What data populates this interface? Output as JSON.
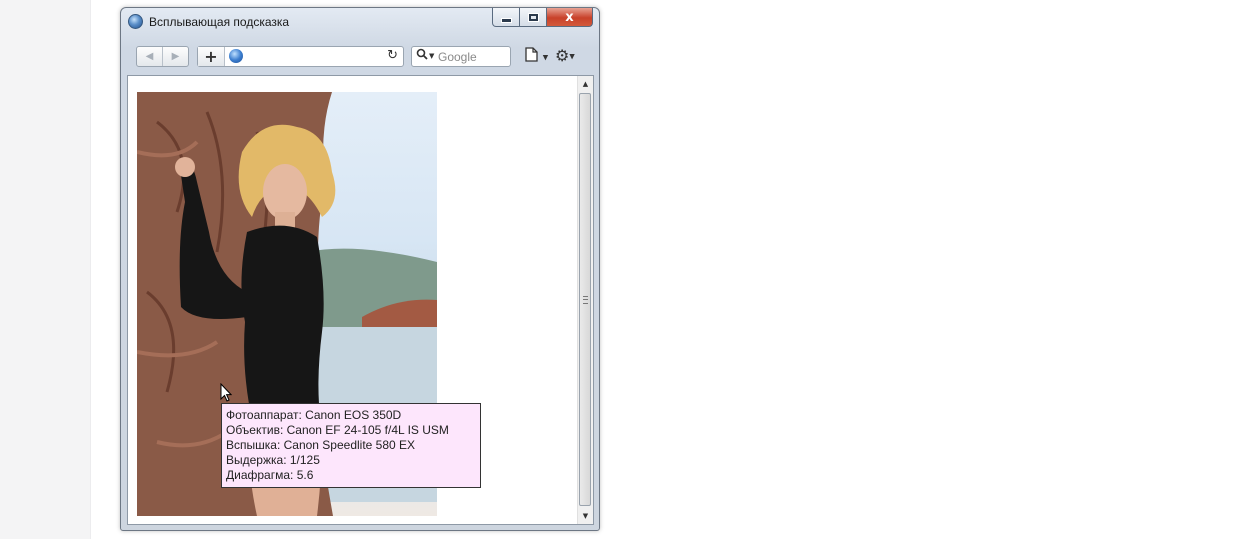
{
  "window": {
    "title": "Всплывающая подсказка",
    "close_glyph": "x"
  },
  "toolbar": {
    "back_icon": "◀",
    "forward_icon": "▶",
    "add_tab_icon": "+",
    "reload_icon": "↻",
    "search_icon": "⚲",
    "search_placeholder": "Google",
    "page_menu_icon": "🗋",
    "settings_icon": "⚙",
    "dropdown_icon": "▼"
  },
  "scrollbar": {
    "up_icon": "▲",
    "down_icon": "▼"
  },
  "tooltip": {
    "lines": [
      "Фотоаппарат: Canon EOS 350D",
      "Объектив: Canon EF 24-105 f/4L IS USM",
      "Вспышка: Canon Speedlite 580 EX",
      "Выдержка: 1/125",
      "Диафрагма: 5.6"
    ]
  },
  "colors": {
    "tooltip_background": "#fde6fc",
    "close_button": "#c8412a"
  }
}
